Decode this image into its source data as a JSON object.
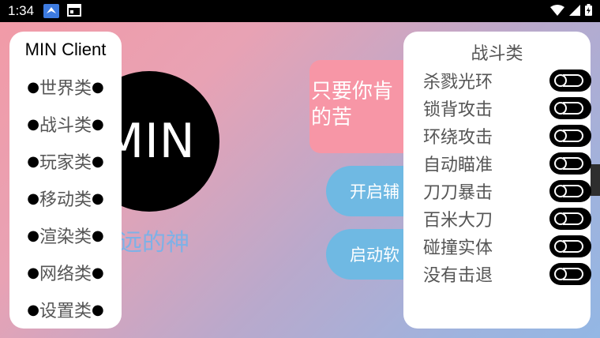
{
  "status_bar": {
    "time": "1:34",
    "icons": [
      "notification-app-icon",
      "calendar-icon",
      "wifi-icon",
      "cellular-icon",
      "battery-icon"
    ]
  },
  "logo": {
    "text": "MIN"
  },
  "tagline": "远的神",
  "quote": {
    "line1": "只要你肯",
    "line2": "的苦"
  },
  "buttons": {
    "enable_assist": "开启辅",
    "launch_software": "启动软"
  },
  "left_menu": {
    "title": "MIN Client",
    "items": [
      "世界类",
      "战斗类",
      "玩家类",
      "移动类",
      "渲染类",
      "网络类",
      "设置类"
    ],
    "bullet": "●"
  },
  "combat_panel": {
    "title": "战斗类",
    "toggles": [
      {
        "label": "杀戮光环",
        "on": false
      },
      {
        "label": "锁背攻击",
        "on": false
      },
      {
        "label": "环绕攻击",
        "on": false
      },
      {
        "label": "自动瞄准",
        "on": false
      },
      {
        "label": "刀刀暴击",
        "on": false
      },
      {
        "label": "百米大刀",
        "on": false
      },
      {
        "label": "碰撞实体",
        "on": false
      },
      {
        "label": "没有击退",
        "on": false
      }
    ]
  },
  "colors": {
    "quote_bg": "#f796a6",
    "button_bg": "#6fb9e3",
    "tagline": "#7eb1e6"
  }
}
